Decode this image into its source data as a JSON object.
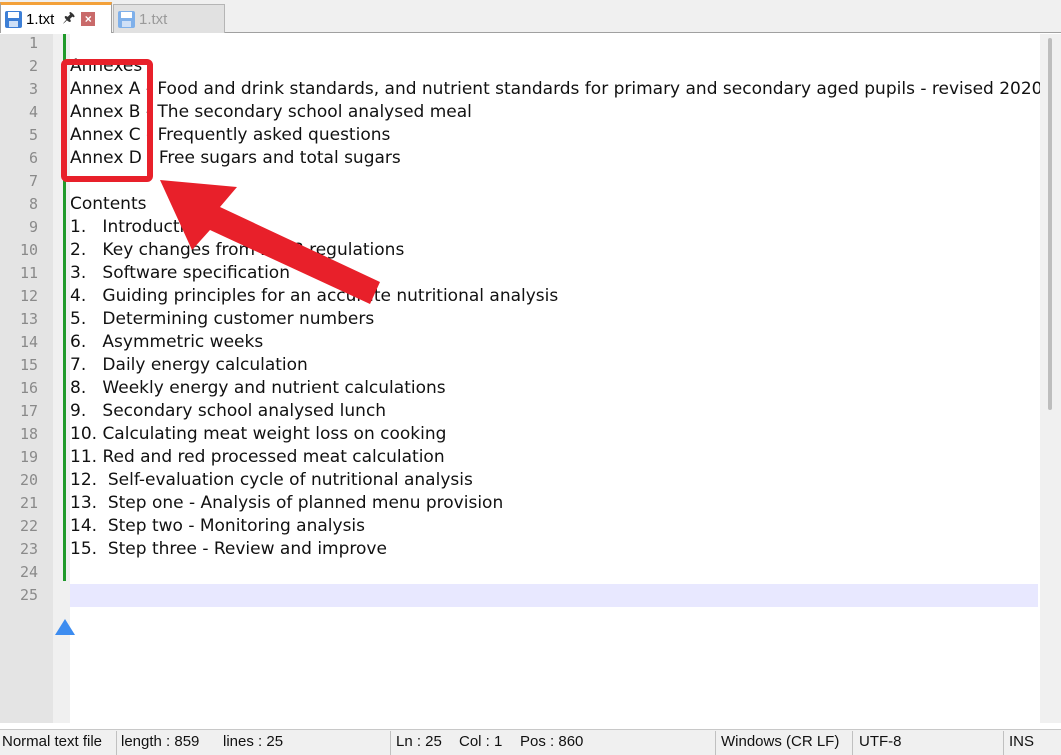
{
  "tabs": [
    {
      "label": "1.txt",
      "active": true
    },
    {
      "label": "1.txt",
      "active": false
    }
  ],
  "lines": [
    "",
    "Annexes",
    "Annex A - Food and drink standards, and nutrient standards for primary and secondary aged pupils - revised 2020",
    "Annex B - The secondary school analysed meal",
    "Annex C - Frequently asked questions",
    "Annex D - Free sugars and total sugars",
    "",
    "Contents",
    "1.   Introduction",
    "2.   Key changes from 2008 regulations",
    "3.   Software specification",
    "4.   Guiding principles for an accurate nutritional analysis",
    "5.   Determining customer numbers",
    "6.   Asymmetric weeks",
    "7.   Daily energy calculation",
    "8.   Weekly energy and nutrient calculations",
    "9.   Secondary school analysed lunch",
    "10. Calculating meat weight loss on cooking",
    "11. Red and red processed meat calculation",
    "12.  Self-evaluation cycle of nutritional analysis",
    "13.  Step one - Analysis of planned menu provision",
    "14.  Step two - Monitoring analysis",
    "15.  Step three - Review and improve",
    "",
    ""
  ],
  "status": {
    "file_type": "Normal text file",
    "length": "length : 859",
    "lines": "lines : 25",
    "ln": "Ln : 25",
    "col": "Col : 1",
    "pos": "Pos : 860",
    "eol": "Windows (CR LF)",
    "encoding": "UTF-8",
    "mode": "INS"
  },
  "colors": {
    "annotation": "#e8202a",
    "change_bar": "#1f9a2a",
    "current_line": "#e8e8ff"
  }
}
